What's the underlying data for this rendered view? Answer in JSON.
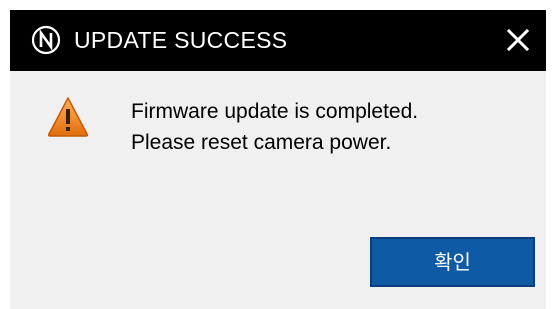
{
  "dialog": {
    "title": "UPDATE SUCCESS",
    "logo_icon": "nikon-n-logo-icon",
    "close_icon": "close-icon",
    "warning_icon": "warning-triangle-icon",
    "message_lines": [
      "Firmware update is completed.",
      "Please reset camera power."
    ],
    "ok_button_label": "확인"
  },
  "colors": {
    "titlebar_bg": "#000000",
    "titlebar_text": "#ffffff",
    "dialog_bg": "#f0f0f0",
    "button_bg": "#0f5aa5",
    "warning_orange": "#f08a24"
  }
}
